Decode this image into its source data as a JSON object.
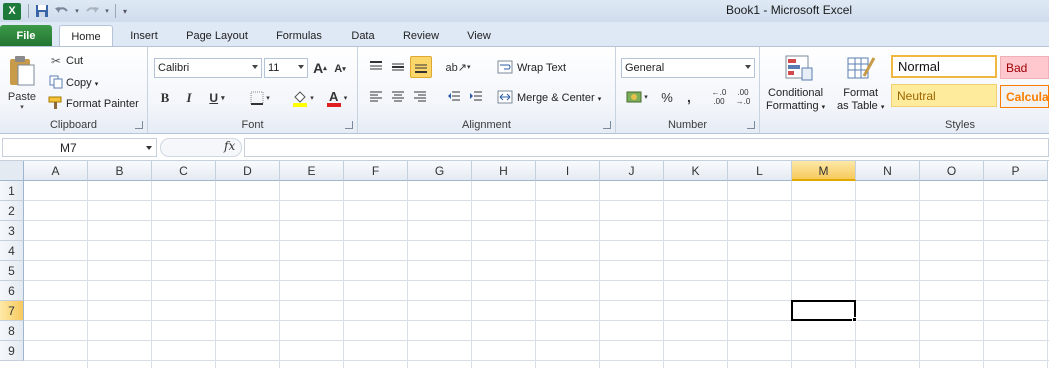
{
  "window": {
    "title": "Book1  -  Microsoft Excel"
  },
  "qat": {
    "logo": "X",
    "save_icon": "save-icon",
    "undo_icon": "undo-icon",
    "redo_icon": "redo-icon"
  },
  "tabs": {
    "file": "File",
    "home": "Home",
    "insert": "Insert",
    "page_layout": "Page Layout",
    "formulas": "Formulas",
    "data": "Data",
    "review": "Review",
    "view": "View"
  },
  "clipboard": {
    "paste": "Paste",
    "cut": "Cut",
    "copy": "Copy",
    "format_painter": "Format Painter",
    "label": "Clipboard"
  },
  "font": {
    "name": "Calibri",
    "size": "11",
    "grow": "A",
    "shrink": "A",
    "bold": "B",
    "italic": "I",
    "underline": "U",
    "font_color_letter": "A",
    "label": "Font"
  },
  "alignment": {
    "wrap_text": "Wrap Text",
    "merge_center": "Merge & Center",
    "label": "Alignment"
  },
  "number": {
    "format": "General",
    "percent": "%",
    "comma": ",",
    "inc_decimal": "←.0 .00",
    "dec_decimal": ".00 →.0",
    "label": "Number"
  },
  "styles": {
    "conditional_line1": "Conditional",
    "conditional_line2": "Formatting",
    "format_table_line1": "Format",
    "format_table_line2": "as Table",
    "normal": "Normal",
    "bad": "Bad",
    "neutral": "Neutral",
    "calculation": "Calculati",
    "label": "Styles"
  },
  "formula_bar": {
    "name_box": "M7",
    "fx": "fx",
    "value": ""
  },
  "sheet": {
    "columns": [
      "A",
      "B",
      "C",
      "D",
      "E",
      "F",
      "G",
      "H",
      "I",
      "J",
      "K",
      "L",
      "M",
      "N",
      "O",
      "P"
    ],
    "rows": [
      "1",
      "2",
      "3",
      "4",
      "5",
      "6",
      "7",
      "8",
      "9"
    ],
    "active_column": "M",
    "active_row": "7"
  },
  "colors": {
    "file_tab": "#237532",
    "selected_header": "#f7c95c",
    "bad_fill": "#ffc7ce",
    "bad_text": "#9c0006",
    "neutral_fill": "#ffeb9c",
    "neutral_text": "#9c6500",
    "calc_text": "#fa7d00"
  }
}
